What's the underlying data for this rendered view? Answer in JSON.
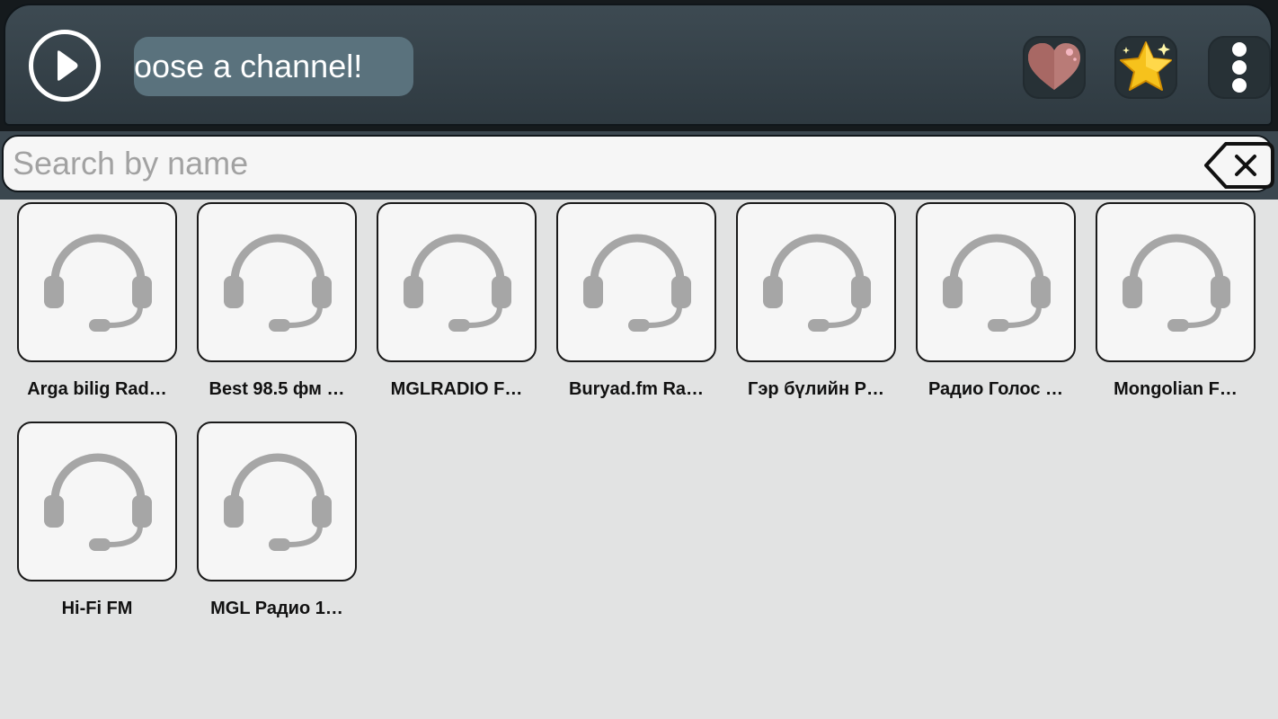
{
  "header": {
    "play_icon": "play-icon",
    "now_playing_text": "Choose a channel!",
    "favorites_icon": "heart-icon",
    "rate_icon": "star-icon",
    "menu_icon": "more-vertical-icon"
  },
  "search": {
    "placeholder": "Search by name",
    "value": "",
    "clear_icon": "backspace-clear-icon"
  },
  "channels": [
    {
      "name": "Arga bilig Rad…",
      "icon": "headset-icon"
    },
    {
      "name": "Best 98.5 фм …",
      "icon": "headset-icon"
    },
    {
      "name": "MGLRADIO F…",
      "icon": "headset-icon"
    },
    {
      "name": "Buryad.fm Ra…",
      "icon": "headset-icon"
    },
    {
      "name": "Гэр бүлийн Р…",
      "icon": "headset-icon"
    },
    {
      "name": "Радио Голос …",
      "icon": "headset-icon"
    },
    {
      "name": "Mongolian F…",
      "icon": "headset-icon"
    },
    {
      "name": "Hi-Fi FM",
      "icon": "headset-icon"
    },
    {
      "name": "MGL Радио 1…",
      "icon": "headset-icon"
    }
  ],
  "colors": {
    "header_bg": "#34414a",
    "marquee_bg": "#5a727d",
    "page_bg": "#e2e3e3",
    "tile_bg": "#f6f6f6",
    "icon_gray": "#a6a6a6"
  }
}
